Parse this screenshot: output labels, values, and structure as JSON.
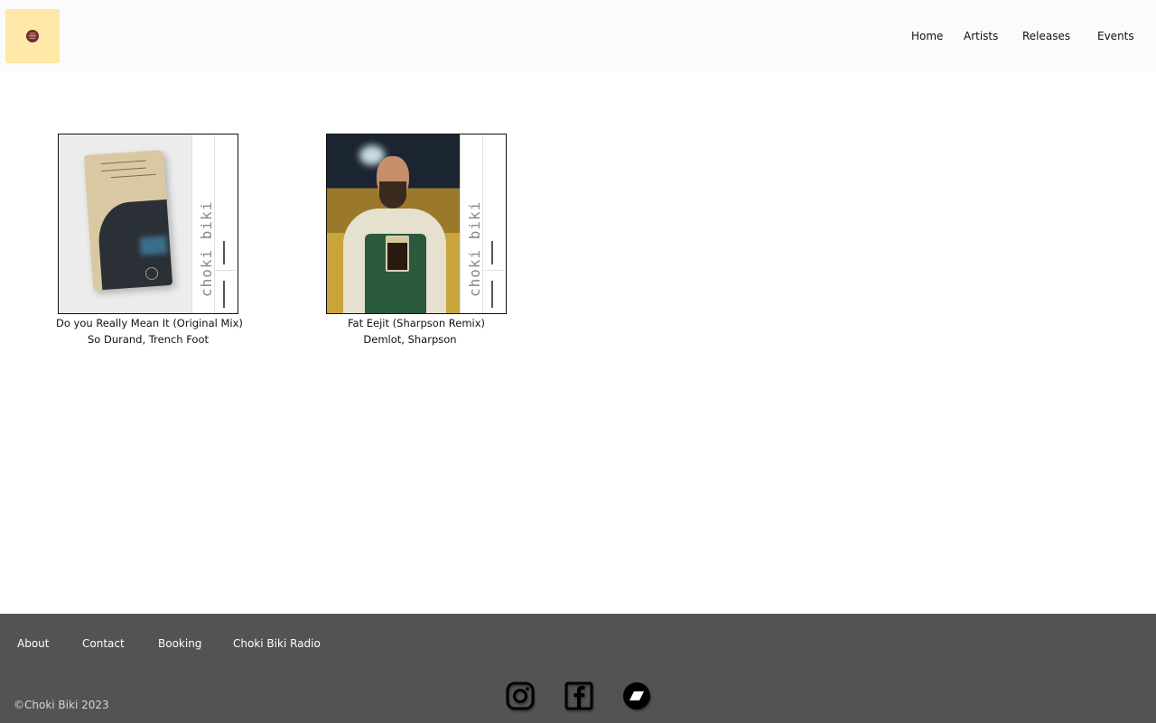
{
  "header": {
    "logo_icon": "choki-biki-logo",
    "nav": [
      {
        "label": "Home"
      },
      {
        "label": "Artists"
      },
      {
        "label": "Releases"
      },
      {
        "label": "Events"
      }
    ]
  },
  "releases": [
    {
      "title": "Do you Really Mean It (Original Mix)",
      "artists": "So Durand, Trench Foot",
      "cover_brand": "choki biki"
    },
    {
      "title": "Fat Eejit (Sharpson Remix)",
      "artists": "Demlot, Sharpson",
      "cover_brand": "choki biki"
    }
  ],
  "footer": {
    "links": [
      {
        "label": "About"
      },
      {
        "label": "Contact"
      },
      {
        "label": "Booking"
      },
      {
        "label": "Choki Biki Radio"
      }
    ],
    "copyright": "©Choki Biki 2023",
    "social": [
      {
        "icon": "instagram-icon"
      },
      {
        "icon": "facebook-icon"
      },
      {
        "icon": "bandcamp-icon"
      }
    ]
  },
  "colors": {
    "header_bg": "#fbfbfb",
    "logo_bg": "#ffe8a8",
    "footer_bg": "#535353"
  }
}
